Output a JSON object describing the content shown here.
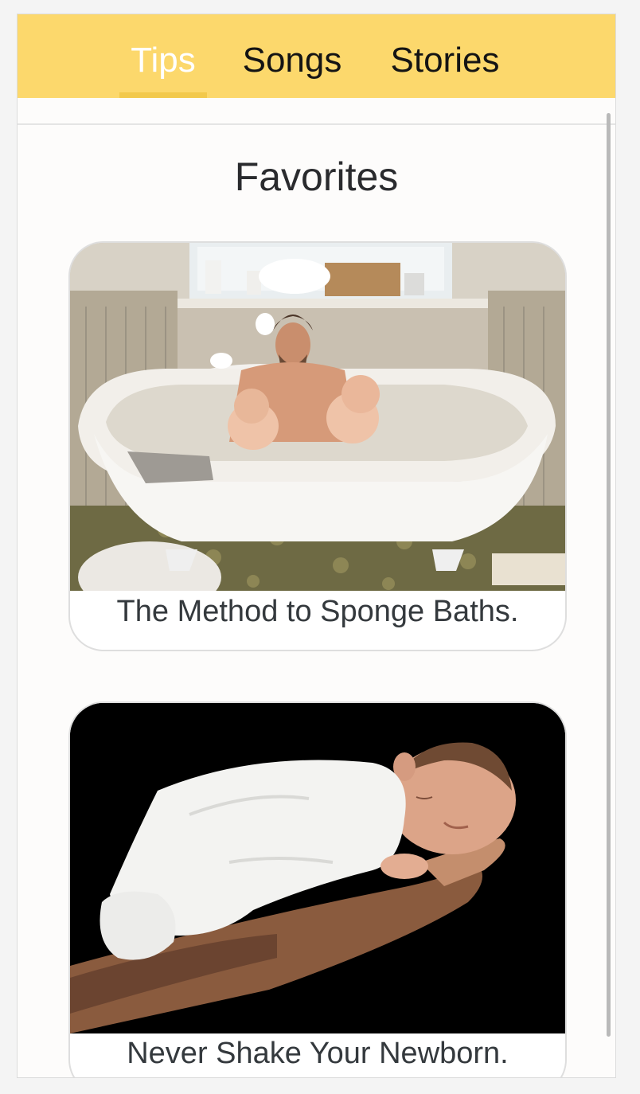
{
  "nav": {
    "tabs": [
      {
        "label": "Tips",
        "active": true
      },
      {
        "label": "Songs",
        "active": false
      },
      {
        "label": "Stories",
        "active": false
      }
    ],
    "accent_color": "#fcd86c",
    "active_tab_text_color": "#ffffff"
  },
  "main": {
    "title": "Favorites",
    "cards": [
      {
        "caption": "The Method to Sponge Baths.",
        "image": "bathtub-photo"
      },
      {
        "caption": "Never Shake Your Newborn.",
        "image": "sleeping-newborn-photo"
      }
    ]
  }
}
